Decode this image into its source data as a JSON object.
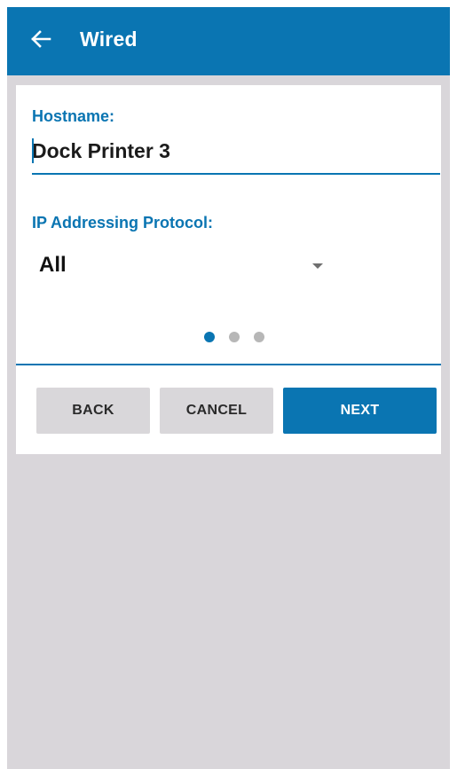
{
  "app_bar": {
    "title": "Wired",
    "back_icon": "arrow-left-icon"
  },
  "form": {
    "hostname": {
      "label": "Hostname:",
      "value": "Dock Printer 3"
    },
    "ip_protocol": {
      "label": "IP Addressing Protocol:",
      "selected": "All",
      "icon": "dropdown-triangle-icon"
    }
  },
  "pagination": {
    "total_pages": 3,
    "current_page": 1
  },
  "buttons": {
    "back": "BACK",
    "cancel": "CANCEL",
    "next": "NEXT"
  },
  "colors": {
    "accent": "#0a75b2",
    "background": "#d9d6da",
    "card": "#ffffff",
    "secondary_button": "#d9d7da",
    "inactive_dot": "#b7b7b7"
  }
}
